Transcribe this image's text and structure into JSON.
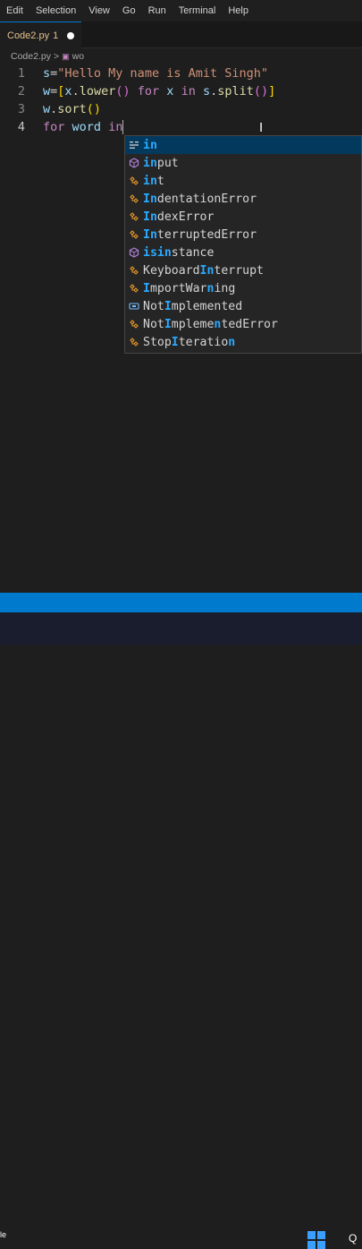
{
  "menu": [
    "Edit",
    "Selection",
    "View",
    "Go",
    "Run",
    "Terminal",
    "Help"
  ],
  "tab": {
    "name": "Code2.py",
    "badge": "1"
  },
  "breadcrumb": {
    "file": "Code2.py",
    "sep": ">",
    "symbol": "wo"
  },
  "editor": {
    "line_numbers": [
      "1",
      "2",
      "3",
      "4"
    ],
    "line1": {
      "var": "s",
      "eq": "=",
      "str": "\"Hello My name is Amit Singh\""
    },
    "line2": {
      "w": "w",
      "eq": "=",
      "lb": "[",
      "x": "x",
      "dot": ".",
      "fn": "lower",
      "p1": "()",
      "for": "for",
      "x2": "x",
      "in": "in",
      "s": "s",
      "dot2": ".",
      "split": "split",
      "p2": "()",
      "rb": "]"
    },
    "line3": {
      "w": "w",
      "dot": ".",
      "fn": "sort",
      "p": "()"
    },
    "line4": {
      "for": "for",
      "word": "word",
      "typed": "in"
    }
  },
  "suggestions": [
    {
      "pre": "",
      "hl": "in",
      "post": "",
      "icon": "keyword-icon"
    },
    {
      "pre": "",
      "hl": "in",
      "post": "put",
      "icon": "method-icon"
    },
    {
      "pre": "",
      "hl": "in",
      "post": "t",
      "icon": "class-icon"
    },
    {
      "pre": "",
      "hl": "In",
      "post": "dentationError",
      "icon": "class-icon"
    },
    {
      "pre": "",
      "hl": "In",
      "post": "dexError",
      "icon": "class-icon"
    },
    {
      "pre": "",
      "hl": "In",
      "post": "terruptedError",
      "icon": "class-icon"
    },
    {
      "pre": "",
      "hl": "isin",
      "post": "stance",
      "icon": "method-icon"
    },
    {
      "pre": "Keyboard",
      "hl": "In",
      "post": "terrupt",
      "icon": "class-icon"
    },
    {
      "pre": "",
      "hl": "I",
      "post": "mportWar",
      "hl2": "n",
      "post2": "ing",
      "icon": "class-icon"
    },
    {
      "pre": "Not",
      "hl": "I",
      "post": "mplemented",
      "icon": "variable-icon"
    },
    {
      "pre": "Not",
      "hl": "I",
      "post": "mpleme",
      "hl2": "n",
      "post2": "tedError",
      "icon": "class-icon"
    },
    {
      "pre": "Stop",
      "hl": "I",
      "post": "teratio",
      "hl2": "n",
      "post2": "",
      "icon": "class-icon"
    }
  ],
  "taskbar": {
    "left_text": "le",
    "search_glyph": "Q"
  },
  "colors": {
    "accent": "#007acc",
    "selection": "#04395e",
    "match": "#2aaaff",
    "icon_class": "#ee9d28",
    "icon_keyword": "#c5c5c5"
  }
}
